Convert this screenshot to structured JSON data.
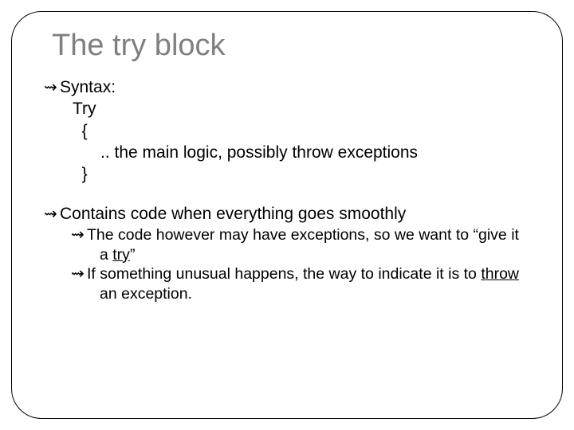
{
  "title": "The try block",
  "b1": "Syntax:",
  "code_l1": "Try",
  "code_l2": "  {",
  "code_l3": "      .. the main logic, possibly throw exceptions",
  "code_l4": "  }",
  "b2": "Contains code when everything goes smoothly",
  "s1_pre": "The code however may have exceptions, so we want to “give it a ",
  "s1_u": "try",
  "s1_post": "”",
  "s2_pre": "If something unusual happens, the way to indicate it is to ",
  "s2_u": "throw",
  "s2_post": " an exception.",
  "glyph": "⇝"
}
